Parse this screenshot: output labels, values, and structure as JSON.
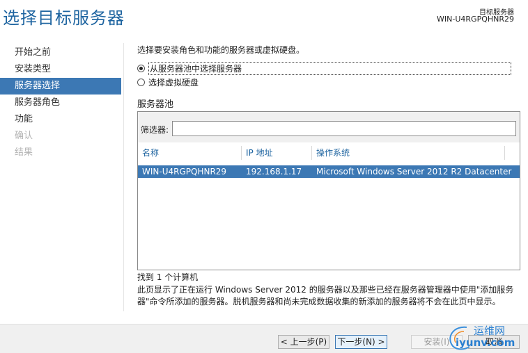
{
  "header": {
    "title": "选择目标服务器",
    "destination_label": "目标服务器",
    "destination_server": "WIN-U4RGPQHNR29"
  },
  "nav": {
    "items": [
      {
        "label": "开始之前",
        "state": "normal"
      },
      {
        "label": "安装类型",
        "state": "normal"
      },
      {
        "label": "服务器选择",
        "state": "active"
      },
      {
        "label": "服务器角色",
        "state": "normal"
      },
      {
        "label": "功能",
        "state": "normal"
      },
      {
        "label": "确认",
        "state": "disabled"
      },
      {
        "label": "结果",
        "state": "disabled"
      }
    ]
  },
  "main": {
    "description": "选择要安装角色和功能的服务器或虚拟硬盘。",
    "options": [
      {
        "label": "从服务器池中选择服务器",
        "selected": true
      },
      {
        "label": "选择虚拟硬盘",
        "selected": false
      }
    ],
    "pool": {
      "heading": "服务器池",
      "filter_label": "筛选器:",
      "filter_value": "",
      "columns": [
        "名称",
        "IP 地址",
        "操作系统"
      ],
      "rows": [
        {
          "name": "WIN-U4RGPQHNR29",
          "ip": "192.168.1.17",
          "os": "Microsoft Windows Server 2012 R2 Datacenter",
          "selected": true
        }
      ]
    },
    "found_text": "找到 1 个计算机",
    "info_text": "此页显示了正在运行 Windows Server 2012 的服务器以及那些已经在服务器管理器中使用\"添加服务器\"命令所添加的服务器。脱机服务器和尚未完成数据收集的新添加的服务器将不会在此页中显示。"
  },
  "footer": {
    "prev_label": "< 上一步(P)",
    "next_label": "下一步(N) >",
    "install_label": "安装(I)",
    "cancel_label": "取消"
  },
  "watermark": {
    "line1": "运维网",
    "line2": "iyunv.com"
  },
  "colors": {
    "accent": "#3c78b4",
    "title": "#1e64a0"
  }
}
